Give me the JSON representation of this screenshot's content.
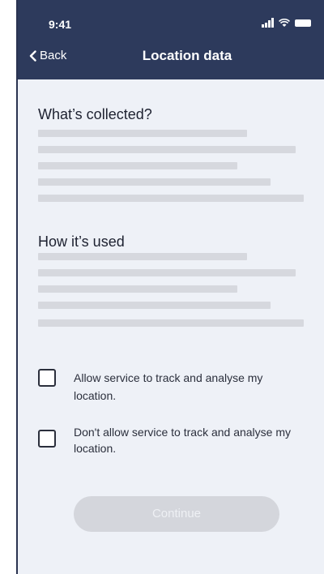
{
  "status_bar": {
    "time": "9:41"
  },
  "nav": {
    "back_label": "Back",
    "title": "Location data"
  },
  "sections": [
    {
      "title": "What’s collected?"
    },
    {
      "title": "How it’s used"
    }
  ],
  "options": [
    {
      "label": "Allow service to track and analyse my location.",
      "checked": false
    },
    {
      "label": "Don't allow service to track and analyse my location.",
      "checked": false
    }
  ],
  "continue_button": {
    "label": "Continue",
    "enabled": false
  },
  "colors": {
    "header": "#2d3a5c",
    "background": "#eef1f7",
    "placeholder_line": "#d6d8de",
    "button_disabled": "#d4d6dc"
  },
  "icons": [
    "chevron-left-icon",
    "signal-icon",
    "wifi-icon",
    "battery-icon"
  ]
}
